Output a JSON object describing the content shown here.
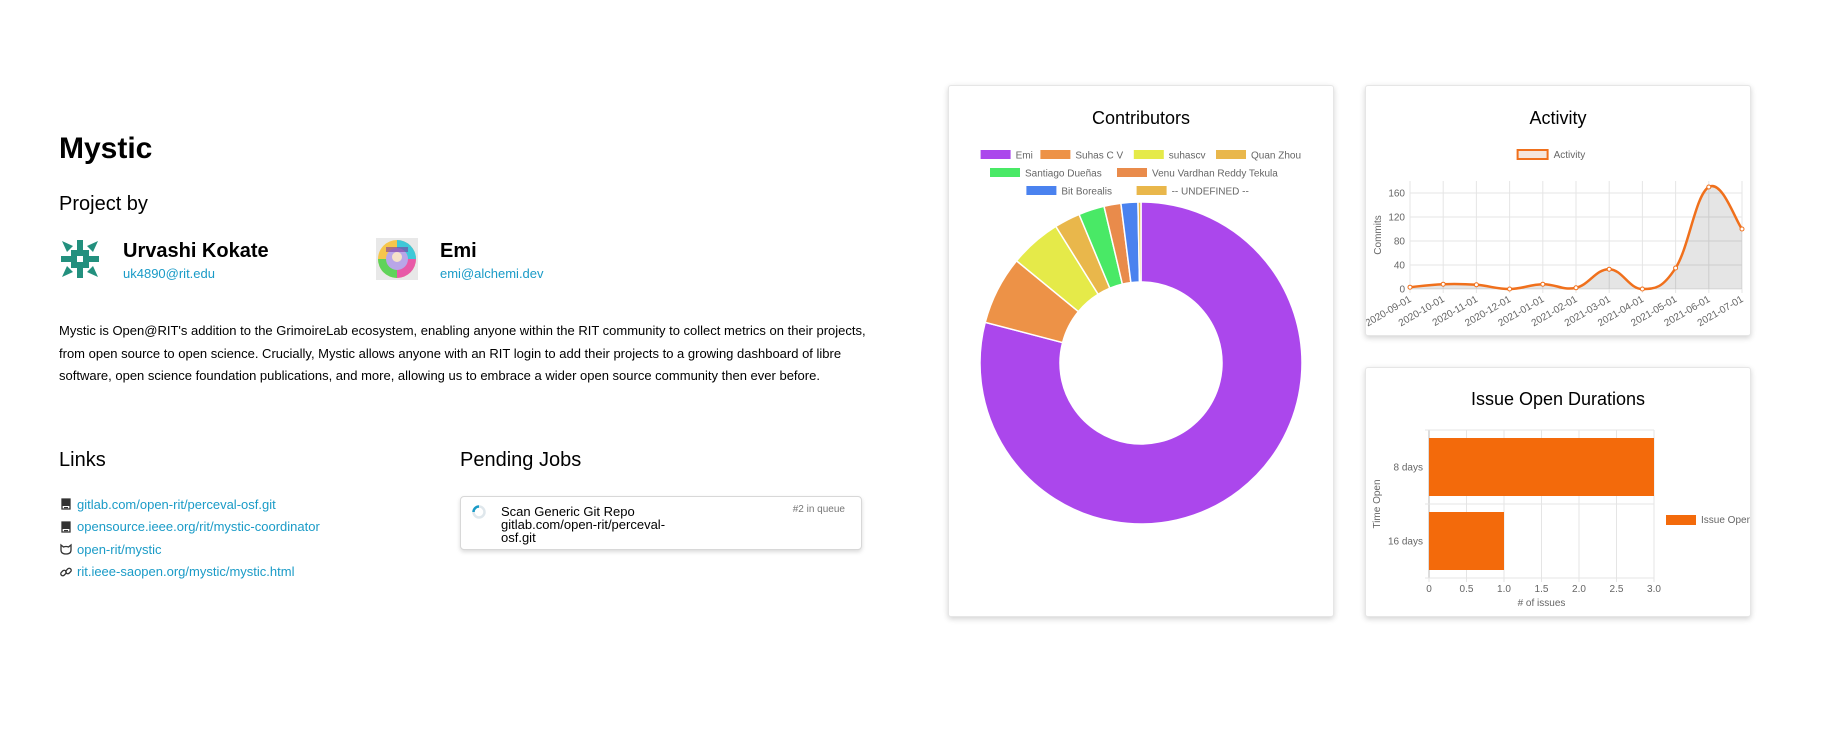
{
  "project": {
    "title": "Mystic",
    "project_by_label": "Project by",
    "description": "Mystic is Open@RIT's addition to the GrimoireLab ecosystem, enabling anyone within the RIT community to collect metrics on their projects, from open source to open science. Crucially, Mystic allows anyone with an RIT login to add their projects to a growing dashboard of libre software, open science foundation publications, and more, allowing us to embrace a wider open source community then ever before."
  },
  "people": [
    {
      "name": "Urvashi Kokate",
      "email": "uk4890@rit.edu",
      "avatar": "green-identicon"
    },
    {
      "name": "Emi",
      "email": "emi@alchemi.dev",
      "avatar": "colorful-circle-avatar"
    }
  ],
  "links": {
    "heading": "Links",
    "items": [
      {
        "text": "gitlab.com/open-rit/perceval-osf.git",
        "icon": "book-icon"
      },
      {
        "text": "opensource.ieee.org/rit/mystic-coordinator",
        "icon": "book-icon"
      },
      {
        "text": "open-rit/mystic",
        "icon": "github-icon"
      },
      {
        "text": "rit.ieee-saopen.org/mystic/mystic.html",
        "icon": "link-icon"
      }
    ]
  },
  "pending_jobs": {
    "heading": "Pending Jobs",
    "items": [
      {
        "title": "Scan Generic Git Repo",
        "subtitle": "gitlab.com/open-rit/perceval-osf.git",
        "queue": "#2 in queue"
      }
    ]
  },
  "chart_data": [
    {
      "type": "pie",
      "title": "Contributors",
      "legend_position": "top",
      "labels": [
        "Emi",
        "Suhas C V",
        "suhascv",
        "Quan Zhou",
        "Santiago Dueñas",
        "Venu Vardhan Reddy Tekula",
        "Bit Borealis",
        "-- UNDEFINED --"
      ],
      "values": [
        79.3,
        6.9,
        5.2,
        2.6,
        2.6,
        1.7,
        1.7,
        0.3
      ],
      "colors": [
        "#ab47ec",
        "#ed9247",
        "#e5ea49",
        "#e9b74b",
        "#49e966",
        "#e98b4b",
        "#4a82ef",
        "#e9b74b"
      ]
    },
    {
      "type": "line",
      "title": "Activity",
      "legend_position": "top",
      "series": [
        {
          "name": "Activity",
          "values": [
            3,
            8,
            7,
            0,
            8,
            2,
            33,
            0,
            35,
            170,
            100
          ]
        }
      ],
      "x": [
        "2020-09-01",
        "2020-10-01",
        "2020-11-01",
        "2020-12-01",
        "2021-01-01",
        "2021-02-01",
        "2021-03-01",
        "2021-04-01",
        "2021-05-01",
        "2021-06-01",
        "2021-07-01"
      ],
      "ylabel": "Commits",
      "ylim": [
        0,
        180
      ],
      "yticks": [
        "0",
        "40",
        "80",
        "120",
        "160"
      ],
      "grid": true,
      "color": "#f0701c"
    },
    {
      "type": "bar",
      "title": "Issue Open Durations",
      "orientation": "horizontal",
      "legend_position": "right",
      "categories": [
        "8 days",
        "16 days"
      ],
      "series": [
        {
          "name": "Issue Open",
          "values": [
            3,
            1
          ]
        }
      ],
      "xlabel": "# of issues",
      "ylabel": "Time Open",
      "xlim": [
        0,
        3
      ],
      "xticks": [
        "0",
        "0.5",
        "1.0",
        "1.5",
        "2.0",
        "2.5",
        "3.0"
      ],
      "grid": true,
      "color": "#f36a0b"
    }
  ]
}
